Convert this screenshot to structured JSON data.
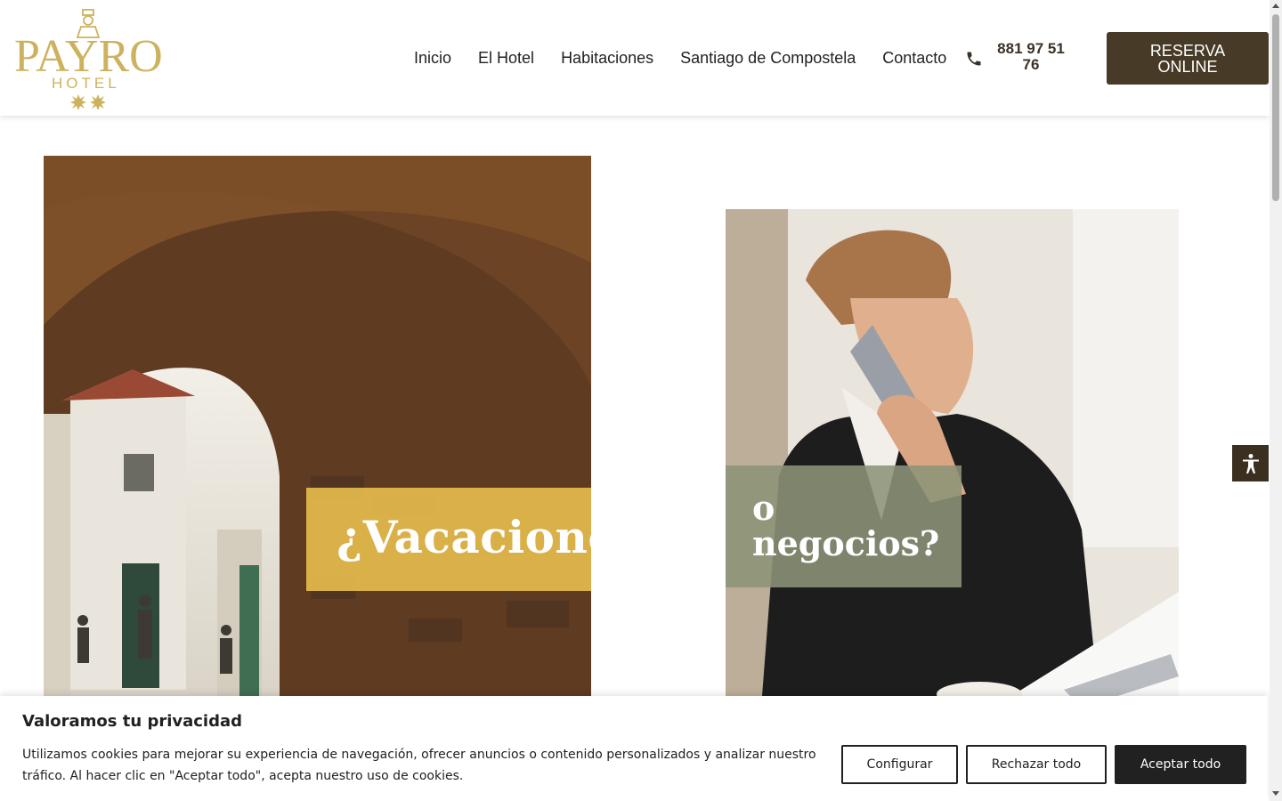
{
  "brand": {
    "logo_text": "PAYRO",
    "logo_subtext": "HOTEL",
    "accent": "#cdb25e",
    "dark": "#473b27"
  },
  "nav": {
    "items": [
      {
        "label": "Inicio"
      },
      {
        "label": "El Hotel"
      },
      {
        "label": "Habitaciones"
      },
      {
        "label": "Santiago de Compostela"
      },
      {
        "label": "Contacto"
      }
    ]
  },
  "phone": {
    "icon": "phone-icon",
    "number": "881 97 51 76"
  },
  "reserve": {
    "label": "RESERVA ONLINE"
  },
  "hero": {
    "left_label": "¿Vacaciones",
    "right_label": "o negocios?",
    "left_color": "#e5bb4c",
    "right_color": "#8c9478"
  },
  "accessibility": {
    "icon": "accessibility-icon"
  },
  "cookie": {
    "title": "Valoramos tu privacidad",
    "text": "Utilizamos cookies para mejorar su experiencia de navegación, ofrecer anuncios o contenido personalizados y analizar nuestro tráfico. Al hacer clic en \"Aceptar todo\", acepta nuestro uso de cookies.",
    "configure": "Configurar",
    "reject": "Rechazar todo",
    "accept": "Aceptar todo"
  }
}
